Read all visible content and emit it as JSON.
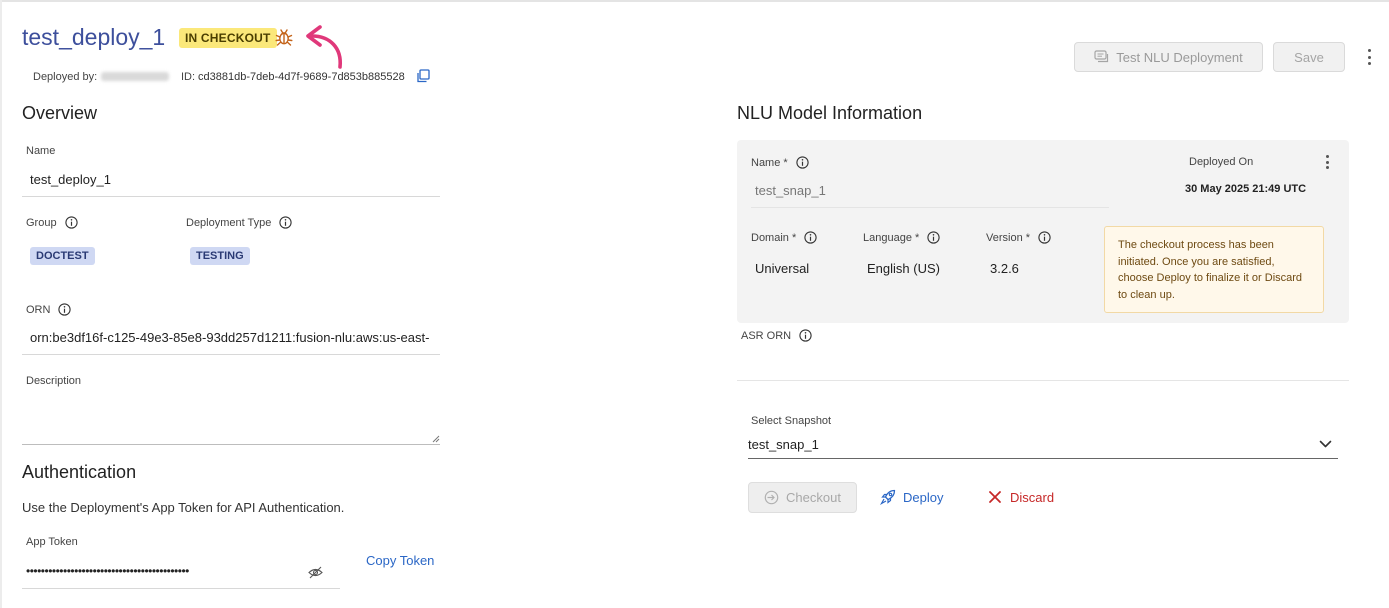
{
  "header": {
    "title": "test_deploy_1",
    "status_badge": "IN CHECKOUT",
    "deployed_by_label": "Deployed by:",
    "id_label": "ID:",
    "id_value": "cd3881db-7deb-4d7f-9689-7d853b885528"
  },
  "toolbar": {
    "test_nlu_label": "Test NLU Deployment",
    "save_label": "Save"
  },
  "overview": {
    "heading": "Overview",
    "name_label": "Name",
    "name_value": "test_deploy_1",
    "group_label": "Group",
    "group_value": "DOCTEST",
    "deployment_type_label": "Deployment Type",
    "deployment_type_value": "TESTING",
    "orn_label": "ORN",
    "orn_value": "orn:be3df16f-c125-49e3-85e8-93dd257d1211:fusion-nlu:aws:us-east-",
    "description_label": "Description",
    "description_value": ""
  },
  "authentication": {
    "heading": "Authentication",
    "description": "Use the Deployment's App Token for API Authentication.",
    "app_token_label": "App Token",
    "app_token_value": "••••••••••••••••••••••••••••••••••••••••••••",
    "copy_token_label": "Copy Token"
  },
  "nlu_model": {
    "heading": "NLU Model Information",
    "name_label": "Name *",
    "name_value": "test_snap_1",
    "deployed_on_label": "Deployed On",
    "deployed_on_value": "30 May 2025 21:49 UTC",
    "domain_label": "Domain *",
    "domain_value": "Universal",
    "language_label": "Language *",
    "language_value": "English (US)",
    "version_label": "Version *",
    "version_value": "3.2.6",
    "notice": "The checkout process has been initiated. Once you are satisfied, choose Deploy to finalize it or Discard to clean up.",
    "asr_orn_label": "ASR ORN"
  },
  "snapshot": {
    "select_label": "Select Snapshot",
    "select_value": "test_snap_1"
  },
  "actions": {
    "checkout_label": "Checkout",
    "deploy_label": "Deploy",
    "discard_label": "Discard"
  },
  "colors": {
    "title": "#3d4f9c",
    "badge": "#fbe87a",
    "arrow": "#e0387a",
    "link": "#2b67c6",
    "discard": "#c62828",
    "chip": "#cfd8f3",
    "notice_bg": "#fff8ea"
  }
}
